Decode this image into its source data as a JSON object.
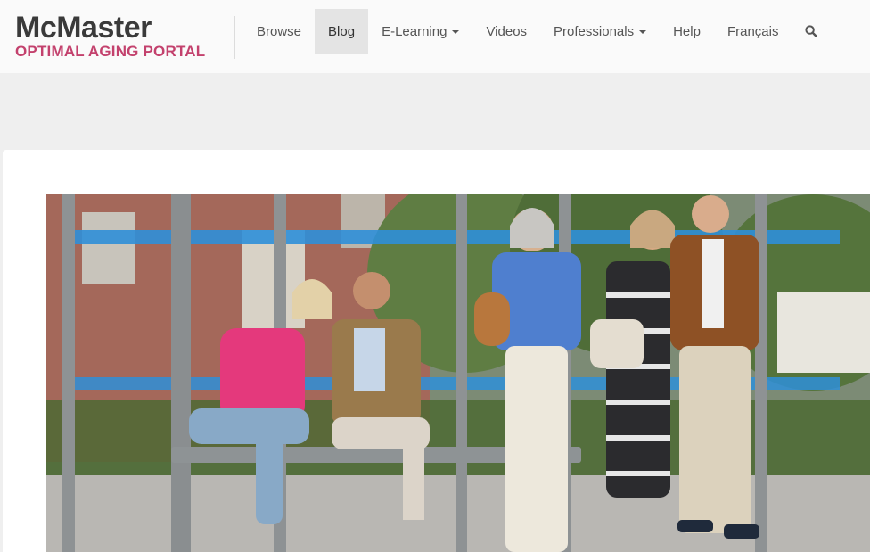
{
  "header": {
    "logo": {
      "line1": "McMaster",
      "line2": "OPTIMAL AGING PORTAL"
    },
    "nav": [
      {
        "label": "Browse",
        "dropdown": false,
        "active": false
      },
      {
        "label": "Blog",
        "dropdown": false,
        "active": true
      },
      {
        "label": "E-Learning",
        "dropdown": true,
        "active": false
      },
      {
        "label": "Videos",
        "dropdown": false,
        "active": false
      },
      {
        "label": "Professionals",
        "dropdown": true,
        "active": false
      },
      {
        "label": "Help",
        "dropdown": false,
        "active": false
      },
      {
        "label": "Français",
        "dropdown": false,
        "active": false
      }
    ],
    "search_icon": "search-icon"
  },
  "colors": {
    "brand_red": "#c3416d",
    "logo_dark": "#3a3a3a",
    "nav_active_bg": "#e4e4e4",
    "page_bg": "#efefef"
  }
}
